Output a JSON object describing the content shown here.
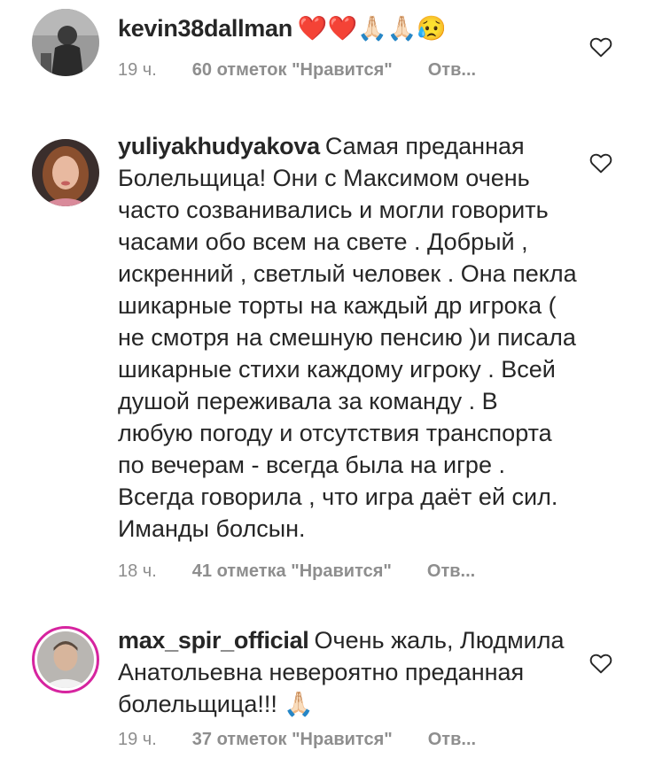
{
  "comments": [
    {
      "username": "kevin38dallman",
      "text": "❤️❤️🙏🏻🙏🏻😥",
      "time": "19 ч.",
      "likes": "60 отметок \"Нравится\"",
      "reply": "Отв..."
    },
    {
      "username": "yuliyakhudyakova",
      "text": "Самая преданная Болельщица! Они с Максимом очень часто созванивались и могли говорить часами обо всем на свете . Добрый , искренний , светлый человек . Она пекла шикарные торты на каждый др игрока ( не смотря на смешную пенсию )и писала шикарные стихи каждому игроку . Всей душой переживала за команду . В любую погоду и отсутствия транспорта по вечерам - всегда была на игре . Всегда говорила , что игра даёт ей сил. Иманды болсын.",
      "time": "18 ч.",
      "likes": "41 отметка \"Нравится\"",
      "reply": "Отв..."
    },
    {
      "username": "max_spir_official",
      "text": "Очень жаль, Людмила Анатольевна невероятно преданная болельщица!!! 🙏🏻",
      "time": "19 ч.",
      "likes": "37 отметок \"Нравится\"",
      "reply": "Отв..."
    }
  ],
  "icons": {
    "like": "heart-outline-icon"
  },
  "colors": {
    "text": "#262626",
    "muted": "#8e8e8e",
    "story_ring": "#d6249f"
  }
}
